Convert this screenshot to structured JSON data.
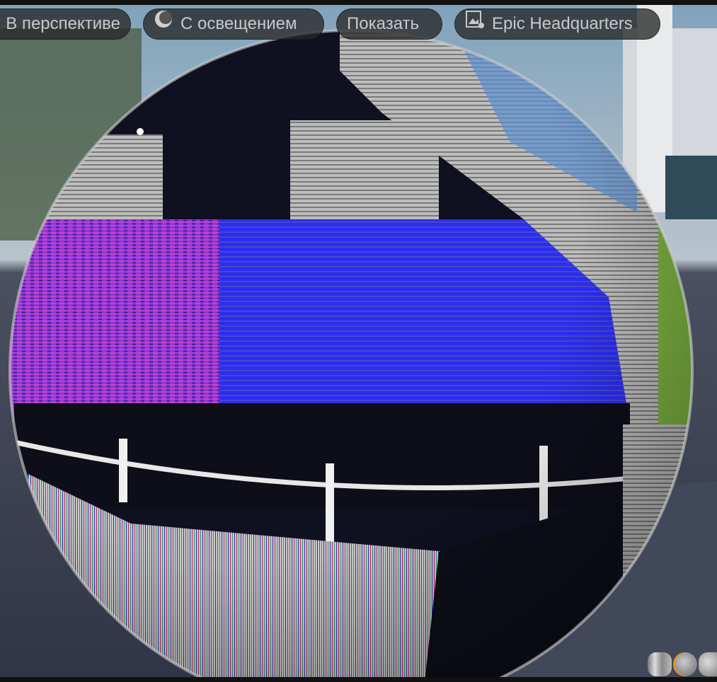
{
  "toolbar": {
    "view_mode": "В перспективе",
    "lighting": "С освещением",
    "show": "Показать",
    "environment": "Epic Headquarters"
  },
  "preview_shapes": [
    "cylinder",
    "sphere",
    "plane"
  ],
  "colors": {
    "accent": "#e8901a",
    "blue_band": "#2a2cf0",
    "sky": "#5a8fb8",
    "floor": "#3d4355"
  }
}
